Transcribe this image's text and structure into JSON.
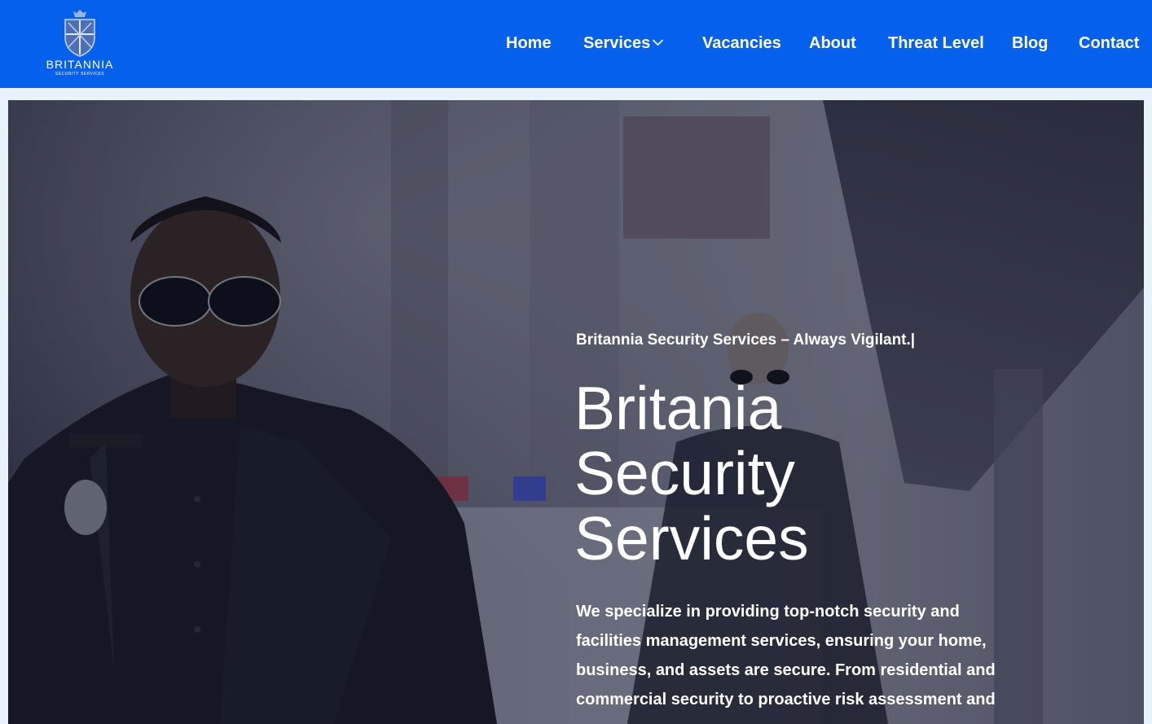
{
  "brand": {
    "name": "BRITANNIA",
    "subtitle": "SECURITY SERVICES"
  },
  "nav": {
    "home": "Home",
    "services": "Services",
    "vacancies": "Vacancies",
    "about": "About",
    "threat_level": "Threat Level",
    "blog": "Blog",
    "contact": "Contact"
  },
  "hero": {
    "tagline": "Britannia Security Services – Always Vigilant.|",
    "title_line1": "Britania",
    "title_line2": "Security",
    "title_line3": "Services",
    "description": "We specialize in providing top-notch security and facilities management services, ensuring your home, business, and assets are secure. From residential and commercial security to proactive risk assessment and"
  },
  "colors": {
    "header_bg": "#0561ec",
    "page_bg": "#e8f2fb",
    "text": "#ffffff"
  }
}
